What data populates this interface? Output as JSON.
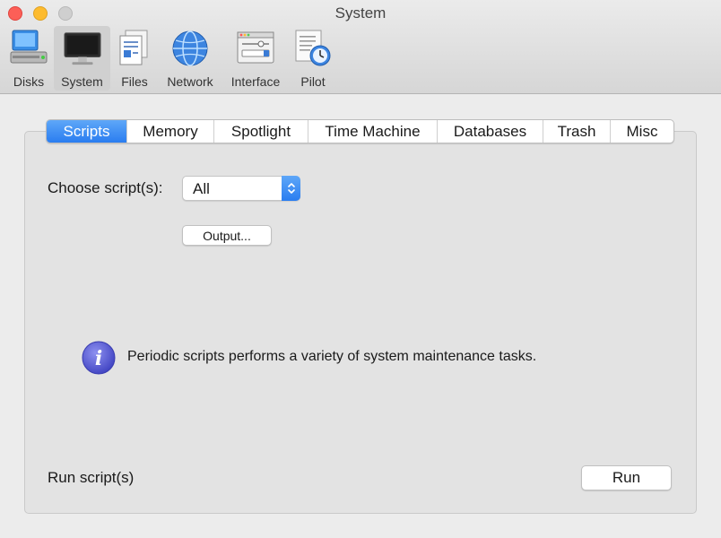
{
  "window": {
    "title": "System"
  },
  "toolbar": {
    "items": [
      {
        "label": "Disks",
        "icon": "disks-icon"
      },
      {
        "label": "System",
        "icon": "system-monitor-icon",
        "selected": true
      },
      {
        "label": "Files",
        "icon": "files-icon"
      },
      {
        "label": "Network",
        "icon": "network-globe-icon"
      },
      {
        "label": "Interface",
        "icon": "interface-window-icon"
      },
      {
        "label": "Pilot",
        "icon": "pilot-clock-icon"
      }
    ]
  },
  "tabs": [
    {
      "label": "Scripts",
      "active": true
    },
    {
      "label": "Memory"
    },
    {
      "label": "Spotlight"
    },
    {
      "label": "Time Machine"
    },
    {
      "label": "Databases"
    },
    {
      "label": "Trash"
    },
    {
      "label": "Misc"
    }
  ],
  "scripts": {
    "choose_label": "Choose script(s):",
    "selected_script": "All",
    "output_button": "Output...",
    "info_text": "Periodic scripts performs a variety of system maintenance tasks.",
    "run_label": "Run script(s)",
    "run_button": "Run"
  },
  "colors": {
    "accent": "#2a7df0",
    "close": "#fc5f57",
    "minimize": "#fdbb2e",
    "info_icon": "#5b5fd6"
  }
}
